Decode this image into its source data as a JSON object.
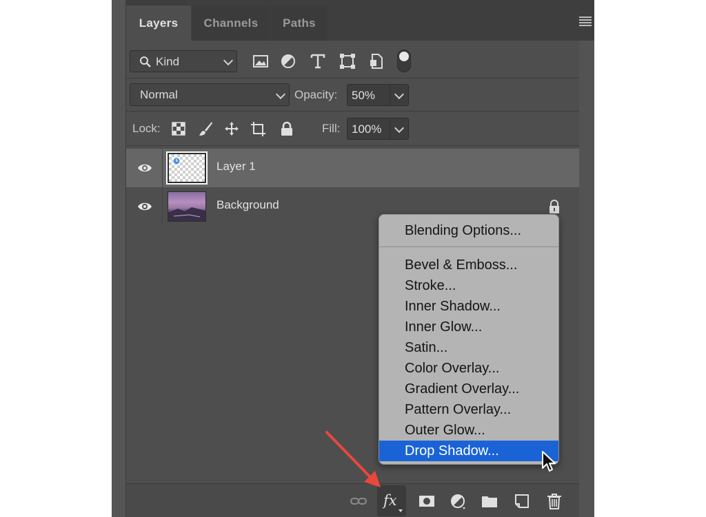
{
  "tabs": [
    {
      "label": "Layers",
      "active": true
    },
    {
      "label": "Channels",
      "active": false
    },
    {
      "label": "Paths",
      "active": false
    }
  ],
  "filter": {
    "kind_label": "Kind",
    "icons": [
      "image-filter-icon",
      "adjustment-filter-icon",
      "type-filter-icon",
      "shape-filter-icon",
      "smart-object-filter-icon"
    ]
  },
  "blend": {
    "mode": "Normal",
    "opacity_label": "Opacity:",
    "opacity_value": "50%"
  },
  "lock": {
    "label": "Lock:",
    "fill_label": "Fill:",
    "fill_value": "100%"
  },
  "layers": [
    {
      "name": "Layer 1",
      "selected": true,
      "thumb": "transparent"
    },
    {
      "name": "Background",
      "selected": false,
      "thumb": "photo",
      "locked": true
    }
  ],
  "context_menu": {
    "items": [
      {
        "label": "Blending Options...",
        "selected": false
      },
      {
        "label": "Bevel & Emboss...",
        "selected": false
      },
      {
        "label": "Stroke...",
        "selected": false
      },
      {
        "label": "Inner Shadow...",
        "selected": false
      },
      {
        "label": "Inner Glow...",
        "selected": false
      },
      {
        "label": "Satin...",
        "selected": false
      },
      {
        "label": "Color Overlay...",
        "selected": false
      },
      {
        "label": "Gradient Overlay...",
        "selected": false
      },
      {
        "label": "Pattern Overlay...",
        "selected": false
      },
      {
        "label": "Outer Glow...",
        "selected": false
      },
      {
        "label": "Drop Shadow...",
        "selected": true
      }
    ]
  },
  "footer": {
    "fx_label": "fx",
    "icons": [
      "link-icon",
      "fx-icon",
      "mask-icon",
      "adjustment-icon",
      "folder-icon",
      "new-layer-icon",
      "trash-icon"
    ]
  },
  "colors": {
    "panel": "#4e4e4e",
    "selected_row": "#666666",
    "menu_bg": "#b4b4b4",
    "menu_highlight": "#1a63d6",
    "annotation_arrow": "#e8483c"
  }
}
